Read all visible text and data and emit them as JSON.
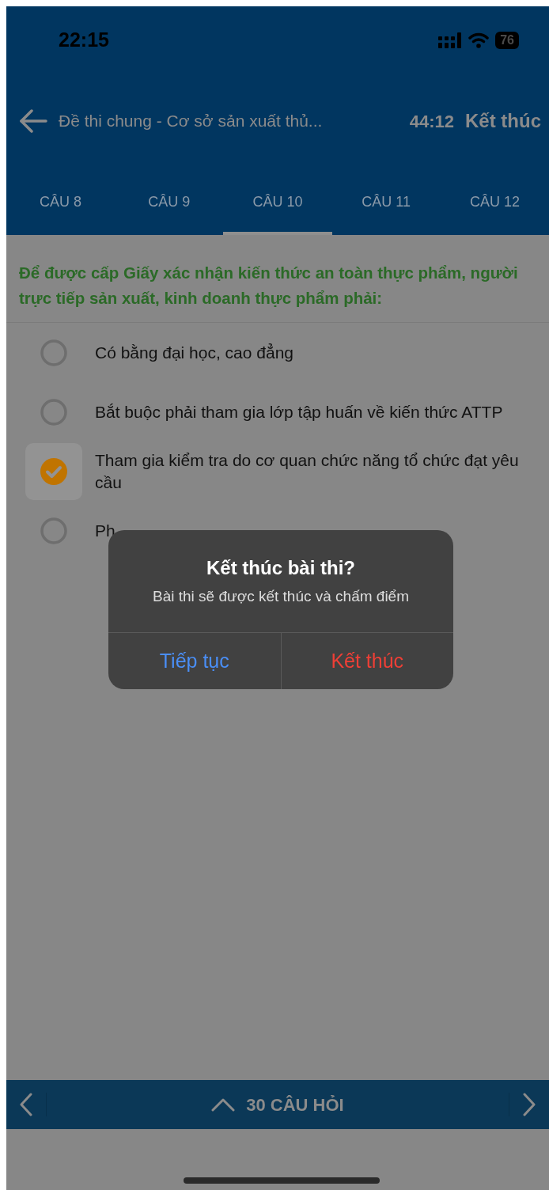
{
  "status_bar": {
    "time": "22:15",
    "battery": "76"
  },
  "header": {
    "title": "Đề thi chung - Cơ sở sản xuất thủ...",
    "timer": "44:12",
    "finish": "Kết thúc"
  },
  "tabs": [
    {
      "label": "CÂU 8",
      "selected": false
    },
    {
      "label": "CÂU 9",
      "selected": false
    },
    {
      "label": "CÂU 10",
      "selected": true
    },
    {
      "label": "CÂU 11",
      "selected": false
    },
    {
      "label": "CÂU 12",
      "selected": false
    }
  ],
  "question": "Để được cấp Giấy xác nhận kiến thức an toàn thực phẩm, người trực tiếp sản xuất, kinh doanh thực phẩm phải:",
  "options": [
    {
      "text": "Có bằng đại học, cao đẳng",
      "selected": false
    },
    {
      "text": "Bắt buộc phải tham gia lớp tập huấn về kiến thức ATTP",
      "selected": false
    },
    {
      "text": "Tham gia kiểm tra do cơ quan chức năng tổ chức đạt yêu cầu",
      "selected": true
    },
    {
      "text": "Ph",
      "selected": false
    }
  ],
  "dialog": {
    "title": "Kết thúc bài thi?",
    "message": "Bài thi sẽ được kết thúc và chấm điểm",
    "buttons": [
      {
        "label": "Tiếp tục",
        "kind": "cancel"
      },
      {
        "label": "Kết thúc",
        "kind": "destructive"
      }
    ]
  },
  "footer": {
    "label": "30 CÂU HỎI"
  }
}
